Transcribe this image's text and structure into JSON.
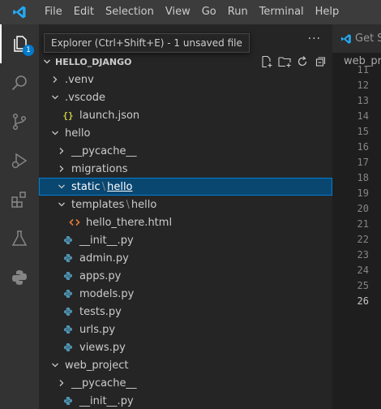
{
  "menu": [
    "File",
    "Edit",
    "Selection",
    "View",
    "Go",
    "Run",
    "Terminal",
    "Help"
  ],
  "activity_bar": {
    "items": [
      "explorer",
      "search",
      "source-control",
      "run-debug",
      "extensions",
      "testing",
      "python"
    ],
    "explorer_badge": "1"
  },
  "tooltip": "Explorer (Ctrl+Shift+E) - 1 unsaved file",
  "sidebar": {
    "more": "···",
    "section_title": "HELLO_DJANGO",
    "tree": [
      {
        "label": ".venv",
        "depth": 1,
        "kind": "folder",
        "expanded": false
      },
      {
        "label": ".vscode",
        "depth": 1,
        "kind": "folder",
        "expanded": true
      },
      {
        "label": "launch.json",
        "depth": 2,
        "kind": "json"
      },
      {
        "label": "hello",
        "depth": 1,
        "kind": "folder",
        "expanded": true
      },
      {
        "label": "__pycache__",
        "depth": 2,
        "kind": "folder",
        "expanded": false
      },
      {
        "label": "migrations",
        "depth": 2,
        "kind": "folder",
        "expanded": false
      },
      {
        "label": "static",
        "label2": "hello",
        "depth": 2,
        "kind": "folder",
        "expanded": true,
        "selected": true
      },
      {
        "label": "templates",
        "label2": "hello",
        "depth": 2,
        "kind": "folder",
        "expanded": true
      },
      {
        "label": "hello_there.html",
        "depth": 3,
        "kind": "html"
      },
      {
        "label": "__init__.py",
        "depth": 2,
        "kind": "python"
      },
      {
        "label": "admin.py",
        "depth": 2,
        "kind": "python"
      },
      {
        "label": "apps.py",
        "depth": 2,
        "kind": "python"
      },
      {
        "label": "models.py",
        "depth": 2,
        "kind": "python"
      },
      {
        "label": "tests.py",
        "depth": 2,
        "kind": "python"
      },
      {
        "label": "urls.py",
        "depth": 2,
        "kind": "python"
      },
      {
        "label": "views.py",
        "depth": 2,
        "kind": "python"
      },
      {
        "label": "web_project",
        "depth": 1,
        "kind": "folder",
        "expanded": true
      },
      {
        "label": "__pycache__",
        "depth": 2,
        "kind": "folder",
        "expanded": false
      },
      {
        "label": "__init__.py",
        "depth": 2,
        "kind": "python"
      }
    ]
  },
  "editor": {
    "tab_label": "Get S",
    "breadcrumb": "web_pr",
    "line_numbers": [
      "11",
      "12",
      "13",
      "14",
      "15",
      "16",
      "17",
      "18",
      "19",
      "20",
      "21",
      "22",
      "23",
      "24",
      "25",
      "26"
    ],
    "current_line": "26"
  },
  "colors": {
    "accent": "#007acc",
    "selection": "#094771",
    "python_icon": "#519aba",
    "json_icon": "#cbcb41",
    "html_icon": "#e37933"
  }
}
